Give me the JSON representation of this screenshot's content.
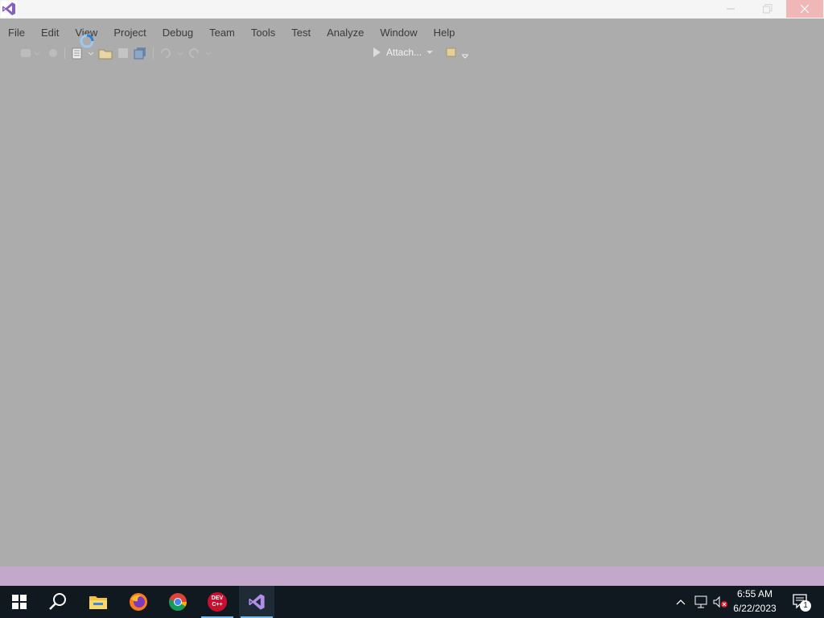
{
  "menu": [
    {
      "name": "menu-file",
      "label": "File"
    },
    {
      "name": "menu-edit",
      "label": "Edit"
    },
    {
      "name": "menu-view",
      "label": "View"
    },
    {
      "name": "menu-project",
      "label": "Project"
    },
    {
      "name": "menu-debug",
      "label": "Debug"
    },
    {
      "name": "menu-team",
      "label": "Team"
    },
    {
      "name": "menu-tools",
      "label": "Tools"
    },
    {
      "name": "menu-test",
      "label": "Test"
    },
    {
      "name": "menu-analyze",
      "label": "Analyze"
    },
    {
      "name": "menu-window",
      "label": "Window"
    },
    {
      "name": "menu-help",
      "label": "Help"
    }
  ],
  "toolbar": {
    "attach_label": "Attach..."
  },
  "taskbar": {
    "apps": [
      "start-icon",
      "search-icon",
      "file-explorer-icon",
      "firefox-icon",
      "chrome-icon",
      "dev-cpp-icon",
      "visual-studio-icon"
    ],
    "devcpp_text": "DEV C++",
    "clock_time": "6:55 AM",
    "clock_date": "6/22/2023",
    "notification_count": "1"
  },
  "colors": {
    "client_bg": "#acacac",
    "status_band": "#c3a8cc",
    "taskbar_bg": "#101820",
    "vs_purple": "#865fc5"
  }
}
